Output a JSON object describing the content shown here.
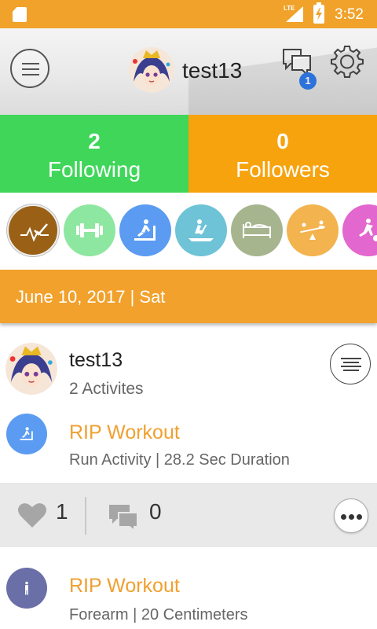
{
  "status_bar": {
    "network": "LTE",
    "time": "3:52"
  },
  "header": {
    "username": "test13",
    "notification_count": "1",
    "icons": [
      "menu-icon",
      "chat-icon",
      "gear-icon"
    ]
  },
  "stats": {
    "following_count": "2",
    "following_label": "Following",
    "followers_count": "0",
    "followers_label": "Followers"
  },
  "filters": [
    {
      "icon": "check-pulse-icon",
      "color": "#9a6116",
      "selected": true
    },
    {
      "icon": "dumbbell-icon",
      "color": "#8ee7a0",
      "selected": false
    },
    {
      "icon": "treadmill-icon",
      "color": "#5b9bf2",
      "selected": false
    },
    {
      "icon": "rowing-icon",
      "color": "#6ec3d6",
      "selected": false
    },
    {
      "icon": "sleep-icon",
      "color": "#a7b58f",
      "selected": false
    },
    {
      "icon": "seesaw-icon",
      "color": "#f3b34e",
      "selected": false
    },
    {
      "icon": "soccer-icon",
      "color": "#e267cf",
      "selected": false
    }
  ],
  "date_banner": "June 10, 2017 | Sat",
  "feed": {
    "post": {
      "username": "test13",
      "activity_count": "2 Activites"
    },
    "activities": [
      {
        "title": "RIP Workout",
        "subtitle": "Run Activity | 28.2 Sec Duration",
        "icon": "treadmill-icon",
        "color": "#5b9bf2"
      },
      {
        "title": "RIP Workout",
        "subtitle": "Forearm | 20 Centimeters",
        "icon": "body-measure-icon",
        "color": "#6a6fa8"
      }
    ],
    "social": {
      "likes": "1",
      "comments": "0"
    }
  },
  "colors": {
    "status_bar": "#f0a22a",
    "following": "#3fd65a",
    "followers": "#f7a30e",
    "date_banner": "#f1a12c",
    "activity_title": "#f0a030"
  }
}
